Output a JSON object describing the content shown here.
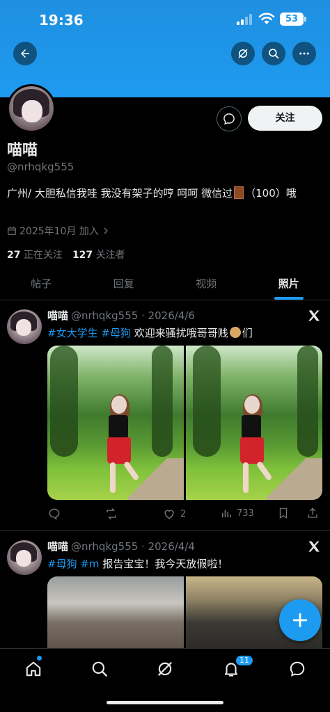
{
  "status": {
    "time": "19:36",
    "battery": "53"
  },
  "profile": {
    "display_name": "喵喵",
    "handle": "@nrhqkg555",
    "bio_part1": "广州/ 大胆私信我哇 我没有架子的哼 呵呵 微信过",
    "bio_part2": "（100）哦",
    "joined": "2025年10月 加入",
    "following_count": "27",
    "following_label": "正在关注",
    "followers_count": "127",
    "followers_label": "关注者",
    "follow_button": "关注"
  },
  "tabs": [
    {
      "label": "帖子"
    },
    {
      "label": "回复"
    },
    {
      "label": "视频"
    },
    {
      "label": "照片"
    }
  ],
  "active_tab": "照片",
  "posts": [
    {
      "name": "喵喵",
      "meta": "@nrhqkg555 · 2026/4/6",
      "tag1": "#女大学生",
      "tag2": "#母狗",
      "text1": "欢迎来骚扰哦哥哥贱",
      "text2": "们",
      "likes": "2",
      "views": "733"
    },
    {
      "name": "喵喵",
      "meta": "@nrhqkg555 · 2026/4/4",
      "tag1": "#母狗",
      "tag2": "#m",
      "text1": "报告宝宝！我今天放假啦！"
    }
  ],
  "nav": {
    "notifications_badge": "11"
  },
  "colors": {
    "accent": "#1d9bf0",
    "background": "#000000",
    "muted": "#71767b"
  },
  "icons": [
    "back-icon",
    "grok-icon",
    "search-icon",
    "more-icon",
    "message-icon",
    "calendar-icon",
    "chevron-right-icon",
    "x-logo-icon",
    "reply-icon",
    "retweet-icon",
    "like-icon",
    "views-icon",
    "bookmark-icon",
    "share-icon",
    "plus-icon",
    "home-icon",
    "bell-icon",
    "chat-icon"
  ]
}
